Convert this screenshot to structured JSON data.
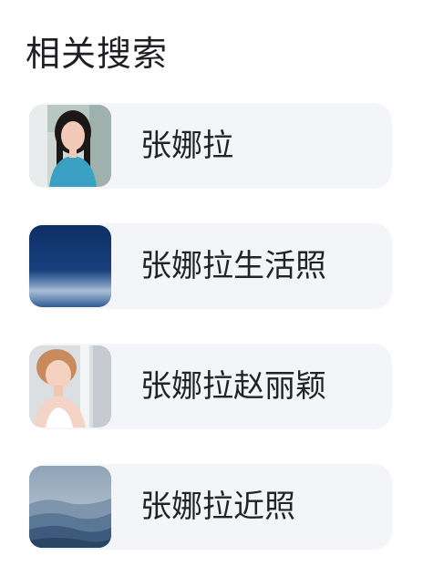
{
  "related": {
    "title": "相关搜索",
    "items": [
      {
        "label": "张娜拉",
        "thumbnail": "portrait-photo"
      },
      {
        "label": "张娜拉生活照",
        "thumbnail": "dark-blue-gradient"
      },
      {
        "label": "张娜拉赵丽颖",
        "thumbnail": "portrait-photo"
      },
      {
        "label": "张娜拉近照",
        "thumbnail": "mountain-landscape"
      }
    ]
  },
  "colors": {
    "item_background": "#f4f5f8",
    "text": "#222326",
    "title": "#1f2023"
  }
}
